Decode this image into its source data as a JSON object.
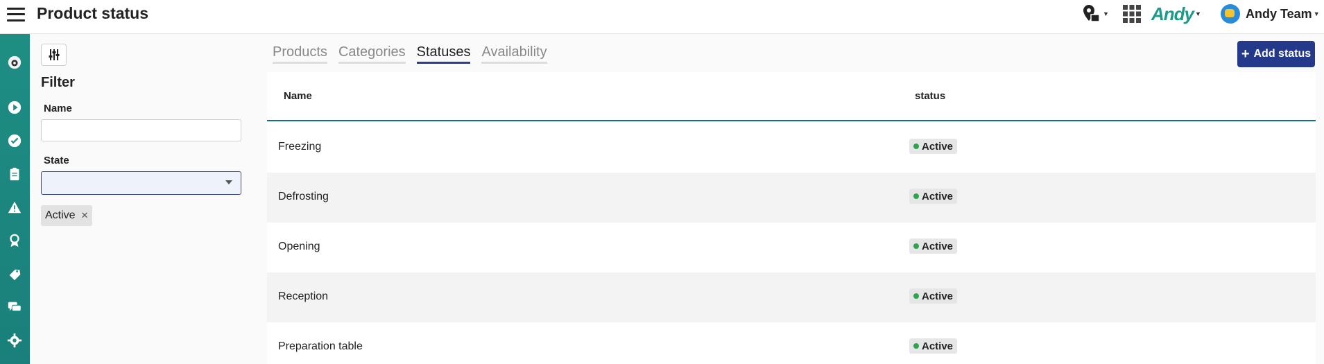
{
  "header": {
    "title": "Product status",
    "brand": "Andy",
    "team_name": "Andy Team"
  },
  "sidebar": {
    "icons": [
      "bee-logo-icon",
      "play-icon",
      "check-icon",
      "clipboard-icon",
      "warning-icon",
      "award-icon",
      "tag-icon",
      "chat-icon",
      "gear-icon"
    ]
  },
  "filter": {
    "title": "Filter",
    "name_label": "Name",
    "name_value": "",
    "state_label": "State",
    "state_value": "",
    "chips": [
      "Active"
    ]
  },
  "tabs": [
    {
      "label": "Products",
      "active": false
    },
    {
      "label": "Categories",
      "active": false
    },
    {
      "label": "Statuses",
      "active": true
    },
    {
      "label": "Availability",
      "active": false
    }
  ],
  "add_button": "Add status",
  "table": {
    "columns": [
      "Name",
      "status"
    ],
    "rows": [
      {
        "name": "Freezing",
        "status": "Active"
      },
      {
        "name": "Defrosting",
        "status": "Active"
      },
      {
        "name": "Opening",
        "status": "Active"
      },
      {
        "name": "Reception",
        "status": "Active"
      },
      {
        "name": "Preparation table",
        "status": "Active"
      }
    ]
  },
  "colors": {
    "sidebar": "#1e8e83",
    "primary": "#24398a",
    "active_dot": "#2ea44f"
  }
}
